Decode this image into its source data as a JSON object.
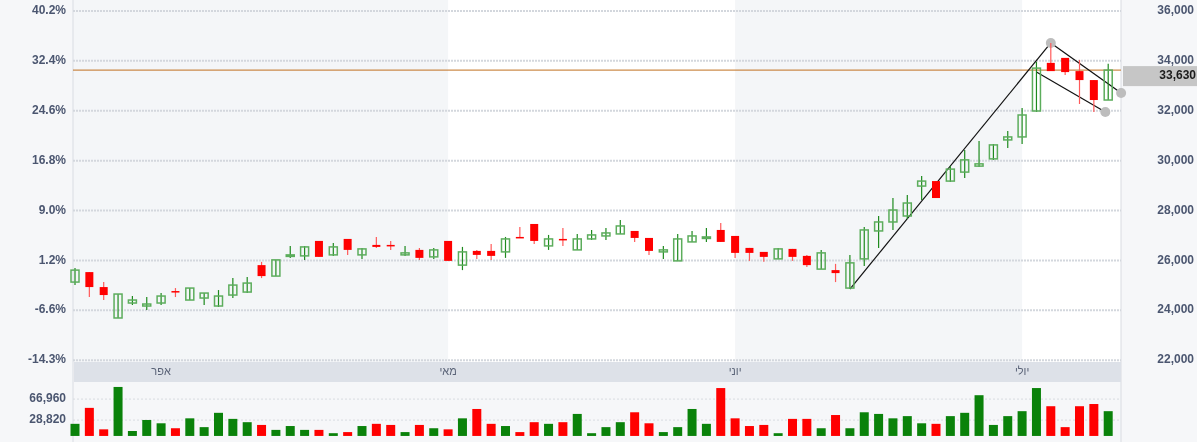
{
  "price_chart": {
    "left_axis_labels": [
      "40.2%",
      "32.4%",
      "24.6%",
      "16.8%",
      "9.0%",
      "1.2%",
      "-6.6%",
      "-14.3%"
    ],
    "last_price": {
      "label": "33,630"
    },
    "chart_data": {
      "type": "candlestick",
      "ylim": [
        21925,
        36441
      ],
      "grid": true,
      "ref_lines": [
        {
          "axis": "y",
          "value": 33630
        }
      ],
      "categories": [
        null,
        null,
        null,
        null,
        null,
        null,
        "אפר",
        null,
        null,
        null,
        null,
        null,
        null,
        null,
        null,
        null,
        null,
        null,
        null,
        null,
        null,
        null,
        null,
        null,
        null,
        null,
        "מאי",
        null,
        null,
        null,
        null,
        null,
        null,
        null,
        null,
        null,
        null,
        null,
        null,
        null,
        null,
        null,
        null,
        null,
        null,
        null,
        "יוני",
        null,
        null,
        null,
        null,
        null,
        null,
        null,
        null,
        null,
        null,
        null,
        null,
        null,
        null,
        null,
        null,
        null,
        null,
        null,
        "יולי",
        null,
        null,
        null,
        null,
        null,
        null
      ],
      "yticks": [
        {
          "value": 36000,
          "label": "36,000"
        },
        {
          "value": 34000,
          "label": "34,000"
        },
        {
          "value": 32000,
          "label": "32,000"
        },
        {
          "value": 30000,
          "label": "30,000"
        },
        {
          "value": 28000,
          "label": "28,000"
        },
        {
          "value": 26000,
          "label": "26,000"
        },
        {
          "value": 24000,
          "label": "24,000"
        },
        {
          "value": 22000,
          "label": "22,000"
        }
      ],
      "ohlc": [
        [
          25130,
          25690,
          25010,
          25610
        ],
        [
          25530,
          25530,
          24530,
          24930
        ],
        [
          24930,
          25130,
          24410,
          24610
        ],
        [
          23690,
          24650,
          23690,
          24650
        ],
        [
          24290,
          24570,
          24210,
          24410
        ],
        [
          24170,
          24530,
          24010,
          24250
        ],
        [
          24290,
          24690,
          24210,
          24570
        ],
        [
          24770,
          24890,
          24530,
          24730
        ],
        [
          24410,
          24890,
          24410,
          24890
        ],
        [
          24490,
          24690,
          24210,
          24690
        ],
        [
          24170,
          24810,
          24130,
          24570
        ],
        [
          24610,
          25290,
          24490,
          25010
        ],
        [
          24730,
          25330,
          24690,
          25090
        ],
        [
          25810,
          25940,
          25290,
          25370
        ],
        [
          25370,
          26020,
          25370,
          26020
        ],
        [
          26180,
          26580,
          26100,
          26220
        ],
        [
          26180,
          26580,
          26020,
          26540
        ],
        [
          26780,
          26780,
          26140,
          26140
        ],
        [
          26220,
          26700,
          26180,
          26540
        ],
        [
          26860,
          26860,
          26220,
          26420
        ],
        [
          26220,
          26500,
          26060,
          26460
        ],
        [
          26620,
          26940,
          26500,
          26540
        ],
        [
          26620,
          26780,
          26420,
          26580
        ],
        [
          26220,
          26580,
          26180,
          26300
        ],
        [
          26420,
          26500,
          26020,
          26100
        ],
        [
          26140,
          26500,
          26060,
          26420
        ],
        [
          26780,
          26780,
          25980,
          25980
        ],
        [
          25810,
          26540,
          25610,
          26340
        ],
        [
          26380,
          26420,
          26060,
          26220
        ],
        [
          26380,
          26660,
          26020,
          26180
        ],
        [
          26340,
          26940,
          26100,
          26860
        ],
        [
          26940,
          27340,
          26900,
          26900
        ],
        [
          27460,
          27460,
          26660,
          26780
        ],
        [
          26580,
          27020,
          26420,
          26860
        ],
        [
          26860,
          27300,
          26580,
          26820
        ],
        [
          26420,
          27060,
          26420,
          26860
        ],
        [
          26860,
          27220,
          26820,
          27020
        ],
        [
          26980,
          27300,
          26820,
          27100
        ],
        [
          27060,
          27620,
          27060,
          27380
        ],
        [
          27180,
          27180,
          26740,
          26900
        ],
        [
          26900,
          26900,
          26220,
          26380
        ],
        [
          26340,
          26580,
          26060,
          26420
        ],
        [
          25980,
          27060,
          25980,
          26860
        ],
        [
          26740,
          27180,
          26740,
          26980
        ],
        [
          26900,
          27300,
          26740,
          26940
        ],
        [
          27220,
          27500,
          26740,
          26740
        ],
        [
          26980,
          26980,
          26100,
          26300
        ],
        [
          26500,
          26500,
          25980,
          26300
        ],
        [
          26340,
          26340,
          25940,
          26140
        ],
        [
          26060,
          26500,
          26060,
          26460
        ],
        [
          26460,
          26460,
          25980,
          26140
        ],
        [
          26180,
          26220,
          25730,
          25810
        ],
        [
          25650,
          26420,
          25650,
          26300
        ],
        [
          25610,
          25860,
          25130,
          25490
        ],
        [
          24890,
          26220,
          24850,
          25900
        ],
        [
          26060,
          27340,
          25770,
          27220
        ],
        [
          27180,
          27780,
          26500,
          27540
        ],
        [
          27540,
          28500,
          27220,
          28020
        ],
        [
          27780,
          28620,
          27660,
          28300
        ],
        [
          28980,
          29380,
          28420,
          29180
        ],
        [
          29180,
          29180,
          28500,
          28500
        ],
        [
          29180,
          29780,
          29140,
          29660
        ],
        [
          29540,
          30430,
          29300,
          30030
        ],
        [
          29780,
          30790,
          29740,
          29870
        ],
        [
          30070,
          30670,
          30030,
          30630
        ],
        [
          30830,
          31190,
          30510,
          30950
        ],
        [
          30950,
          32110,
          30670,
          31830
        ],
        [
          31990,
          33960,
          31950,
          33710
        ],
        [
          33920,
          34720,
          33590,
          33590
        ],
        [
          34120,
          34120,
          33430,
          33550
        ],
        [
          33590,
          34040,
          32270,
          33230
        ],
        [
          33230,
          33230,
          31950,
          32430
        ],
        [
          32430,
          33880,
          32430,
          33630
        ]
      ]
    }
  },
  "volume_chart": {
    "chart_data": {
      "type": "bar",
      "ylim": [
        -11000,
        98000
      ],
      "yticks": [
        {
          "value": 66960,
          "label": "66,960"
        },
        {
          "value": 28820,
          "label": "28,820"
        }
      ],
      "values": [
        22000,
        51000,
        12000,
        89000,
        9000,
        29000,
        23000,
        14000,
        32000,
        16000,
        42000,
        31000,
        25000,
        20000,
        11000,
        18000,
        11000,
        11000,
        5000,
        7000,
        18000,
        22000,
        20000,
        7000,
        20000,
        14000,
        12000,
        32000,
        49000,
        22000,
        18000,
        7000,
        25000,
        22000,
        25000,
        40000,
        5000,
        16000,
        25000,
        43000,
        23000,
        7000,
        16000,
        49000,
        22000,
        87000,
        32000,
        18000,
        20000,
        5000,
        31000,
        31000,
        14000,
        38000,
        14000,
        43000,
        40000,
        32000,
        36000,
        23000,
        22000,
        36000,
        42000,
        74000,
        20000,
        36000,
        45000,
        87000,
        54000,
        16000,
        54000,
        58000,
        45000
      ]
    }
  }
}
